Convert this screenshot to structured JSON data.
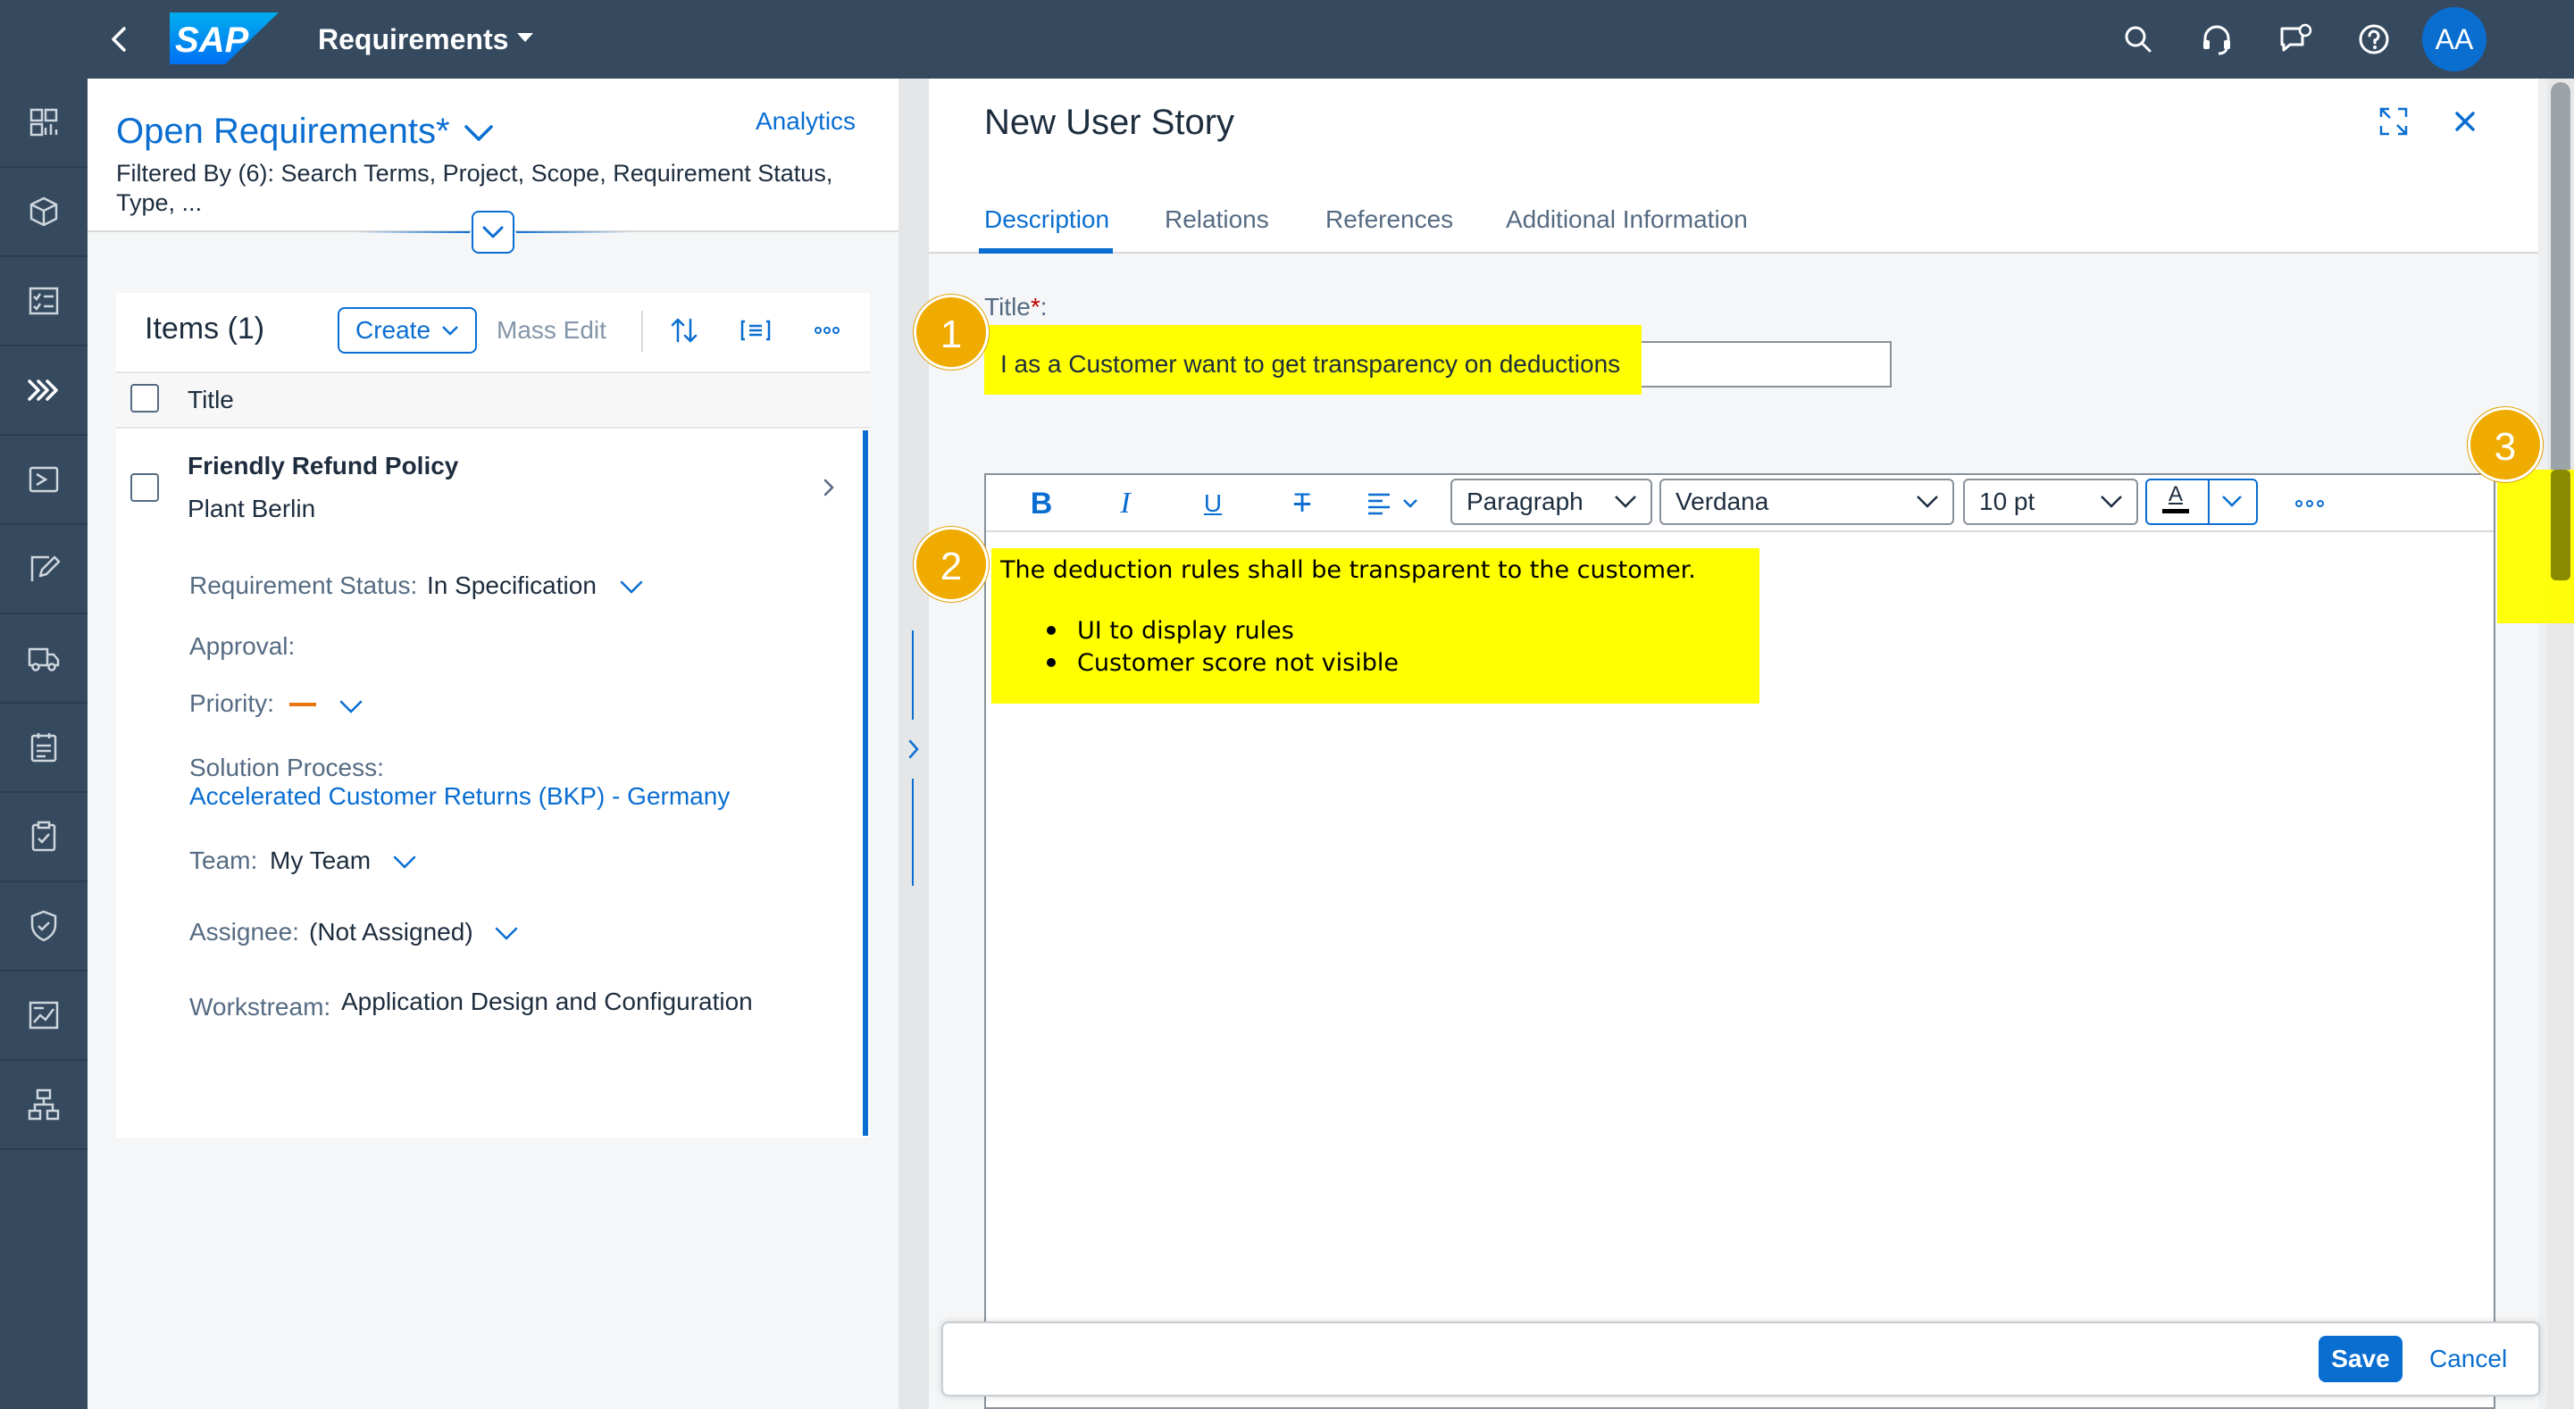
{
  "shell": {
    "logo_text": "SAP",
    "title": "Requirements",
    "avatar_initials": "AA"
  },
  "list": {
    "variant_title": "Open Requirements*",
    "analytics_link": "Analytics",
    "filter_text": "Filtered By (6): Search Terms, Project, Scope, Requirement Status, Type, ...",
    "items_title": "Items (1)",
    "create_label": "Create",
    "mass_edit_label": "Mass Edit",
    "column_title": "Title",
    "item": {
      "title": "Friendly Refund Policy",
      "subtitle": "Plant Berlin",
      "status_label": "Requirement Status:",
      "status_value": "In Specification",
      "approval_label": "Approval:",
      "priority_label": "Priority:",
      "solution_label": "Solution Process:",
      "solution_value": "Accelerated Customer Returns (BKP) - Germany",
      "team_label": "Team:",
      "team_value": "My Team",
      "assignee_label": "Assignee:",
      "assignee_value": "(Not Assigned)",
      "workstream_label": "Workstream:",
      "workstream_value": "Application Design and Configuration"
    }
  },
  "detail": {
    "title": "New User Story",
    "tabs": [
      "Description",
      "Relations",
      "References",
      "Additional Information"
    ],
    "active_tab": "Description",
    "title_field_label": "Title",
    "title_required_marker": "*",
    "title_field_colon": ":",
    "title_value": "I as a Customer want to get transparency on deductions",
    "editor": {
      "bold": "B",
      "italic": "I",
      "underline": "U",
      "strike": "T",
      "paragraph": "Paragraph",
      "font": "Verdana",
      "size": "10 pt",
      "color_letter": "A",
      "body_paragraph": "The deduction rules shall be transparent to the customer.",
      "bullets": [
        "UI to display rules",
        "Customer score not visible"
      ]
    },
    "save_label": "Save",
    "cancel_label": "Cancel"
  },
  "callouts": [
    "1",
    "2",
    "3"
  ],
  "colors": {
    "shell": "#354a5f",
    "accent": "#0a6ed1",
    "highlight": "#ffff00",
    "callout": "#f0ab00",
    "priority_medium": "#e9730c"
  }
}
